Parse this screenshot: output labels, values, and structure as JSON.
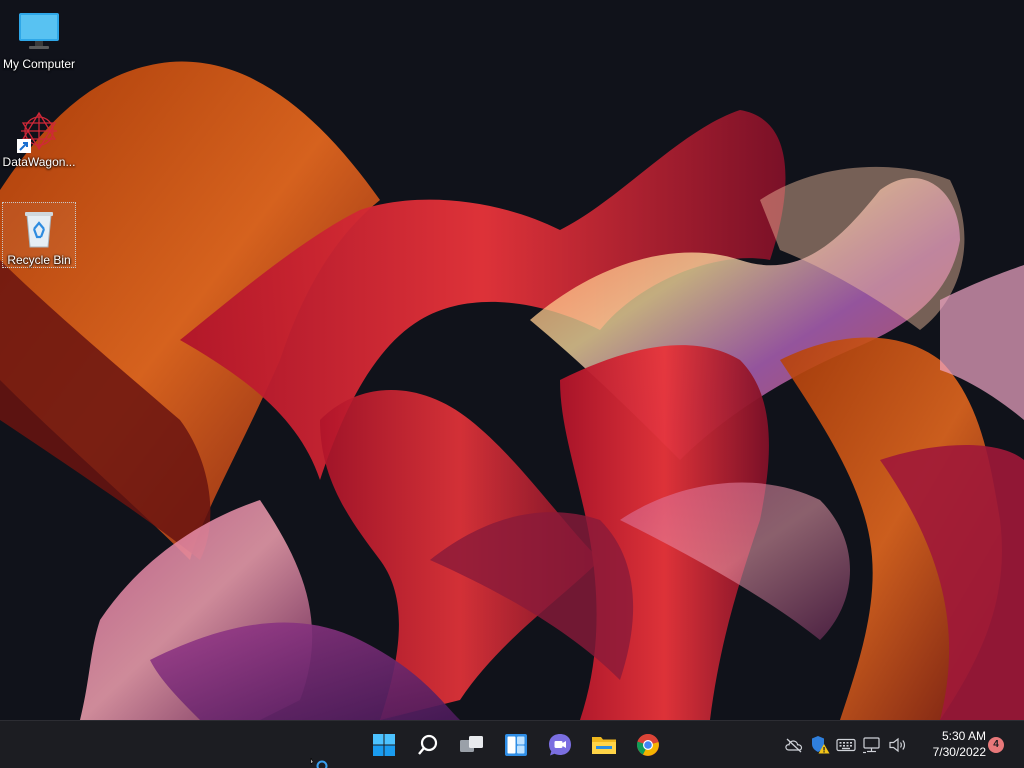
{
  "desktop": {
    "icons": [
      {
        "label": "My Computer",
        "icon": "monitor-icon",
        "selected": false
      },
      {
        "label": "DataWagon...",
        "icon": "datawagon-app-icon",
        "selected": false
      },
      {
        "label": "Recycle Bin",
        "icon": "recycle-bin-icon",
        "selected": true
      }
    ]
  },
  "taskbar": {
    "apps": [
      {
        "icon": "windows-start-icon"
      },
      {
        "icon": "search-icon"
      },
      {
        "icon": "task-view-icon"
      },
      {
        "icon": "widgets-icon"
      },
      {
        "icon": "teams-chat-icon"
      },
      {
        "icon": "file-explorer-icon"
      },
      {
        "icon": "chrome-icon"
      }
    ],
    "tray": [
      {
        "icon": "onedrive-offline-icon"
      },
      {
        "icon": "security-warning-icon"
      },
      {
        "icon": "keyboard-icon"
      },
      {
        "icon": "network-icon"
      },
      {
        "icon": "volume-icon"
      }
    ],
    "clock": {
      "time": "5:30 AM",
      "date": "7/30/2022"
    },
    "notification_count": "4"
  },
  "colors": {
    "taskbar_bg": "#1c1d22",
    "wallpaper_bg": "#10121a",
    "accent_blue": "#3aa0f0"
  }
}
